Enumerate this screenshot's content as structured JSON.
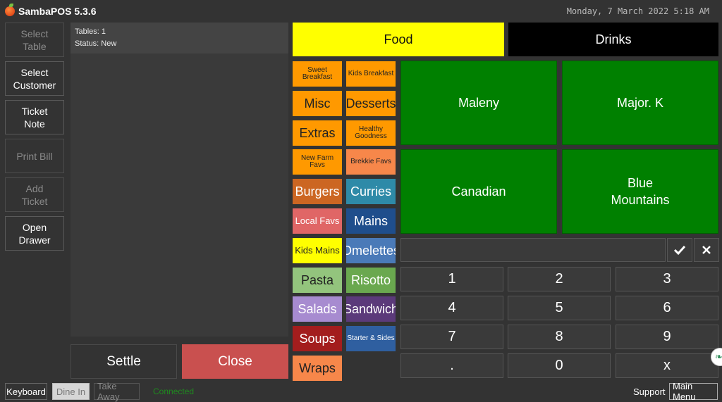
{
  "app": {
    "title": "SambaPOS 5.3.6",
    "datetime": "Monday, 7 March 2022 5:18 AM"
  },
  "sidebar": {
    "select_table": "Select\nTable",
    "select_customer": "Select\nCustomer",
    "ticket_note": "Ticket\nNote",
    "print_bill": "Print Bill",
    "add_ticket": "Add\nTicket",
    "open_drawer": "Open Drawer"
  },
  "ticket": {
    "tables": "Tables: 1",
    "status": "Status: New"
  },
  "actions": {
    "settle": "Settle",
    "close": "Close"
  },
  "tabs": {
    "food": "Food",
    "drinks": "Drinks"
  },
  "categories": [
    {
      "label": "Sweet Breakfast",
      "color": "#ff9900",
      "text": "#222222"
    },
    {
      "label": "Kids Breakfast",
      "color": "#ff9900",
      "text": "#222222"
    },
    {
      "label": "Misc",
      "color": "#ff9900",
      "text": "#222222"
    },
    {
      "label": "Desserts",
      "color": "#ff9900",
      "text": "#222222"
    },
    {
      "label": "Extras",
      "color": "#ff9900",
      "text": "#222222"
    },
    {
      "label": "Healthy Goodness",
      "color": "#ff9900",
      "text": "#222222"
    },
    {
      "label": "New Farm Favs",
      "color": "#ff9900",
      "text": "#222222"
    },
    {
      "label": "Brekkie Favs",
      "color": "#f7874a",
      "text": "#222222"
    },
    {
      "label": "Burgers",
      "color": "#cc6622",
      "text": "#ffffff"
    },
    {
      "label": "Curries",
      "color": "#2e8aa8",
      "text": "#ffffff"
    },
    {
      "label": "Local Favs",
      "color": "#e06666",
      "text": "#ffffff"
    },
    {
      "label": "Mains",
      "color": "#1f4e8c",
      "text": "#ffffff"
    },
    {
      "label": "Kids Mains",
      "color": "#ffff00",
      "text": "#222222"
    },
    {
      "label": "Omelettes",
      "color": "#4a7ab8",
      "text": "#ffffff"
    },
    {
      "label": "Pasta",
      "color": "#93c47d",
      "text": "#222222"
    },
    {
      "label": "Risotto",
      "color": "#6aa84f",
      "text": "#ffffff"
    },
    {
      "label": "Salads",
      "color": "#a78bd0",
      "text": "#ffffff"
    },
    {
      "label": "Sandwich",
      "color": "#5b3a7a",
      "text": "#ffffff"
    },
    {
      "label": "Soups",
      "color": "#a31d1d",
      "text": "#ffffff"
    },
    {
      "label": "Starter & Sides",
      "color": "#2f5fa0",
      "text": "#ffffff"
    },
    {
      "label": "Wraps",
      "color": "#f7874a",
      "text": "#222222"
    }
  ],
  "menu_items": [
    "Maleny",
    "Major. K",
    "Canadian",
    "Blue\nMountains"
  ],
  "numpad": {
    "confirm_icon": "check-icon",
    "clear_icon": "close-icon",
    "keys": [
      "1",
      "2",
      "3",
      "4",
      "5",
      "6",
      "7",
      "8",
      "9",
      ".",
      "0",
      "x"
    ]
  },
  "footer": {
    "keyboard": "Keyboard",
    "dine_in": "Dine In",
    "take_away": "Take Away",
    "connected": "Connected",
    "support": "Support",
    "main_menu": "Main Menu"
  },
  "colors": {
    "background": "#333333",
    "food_tab": "#ffff00",
    "drinks_tab": "#000000",
    "close_button": "#c9504f",
    "menu_item": "#008000"
  }
}
